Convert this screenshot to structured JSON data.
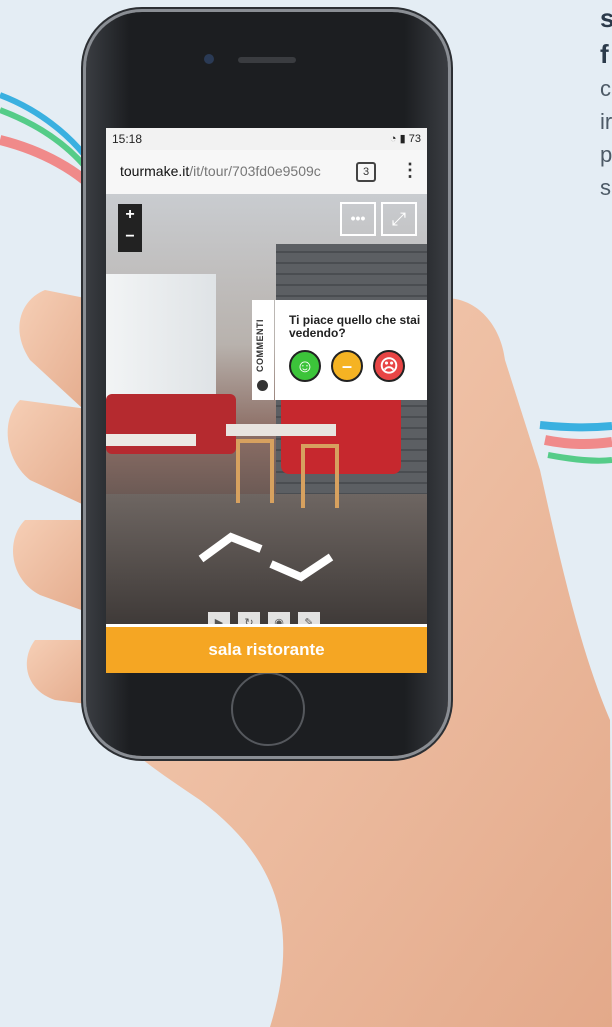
{
  "background_text": {
    "bold_lines": [
      "s",
      "f"
    ],
    "lines": [
      "c",
      "ir",
      "p",
      "s"
    ]
  },
  "status_bar": {
    "time": "15:18",
    "battery": "73"
  },
  "browser": {
    "url_host": "tourmake.it",
    "url_path": "/it/tour/703fd0e9509c",
    "tab_count": "3",
    "menu_icon": "kebab-menu-icon"
  },
  "tour": {
    "zoom_in": "+",
    "zoom_out": "−",
    "more_button": "•••",
    "comment_tab_label": "COMMENTI",
    "rating_question": "Ti piace quello che stai vedendo?",
    "rating_faces": [
      {
        "name": "happy",
        "color": "#3cc43a"
      },
      {
        "name": "neutral",
        "color": "#f5b323"
      },
      {
        "name": "sad",
        "color": "#e84545"
      }
    ],
    "room_name": "sala ristorante"
  },
  "colors": {
    "accent": "#f5a623"
  }
}
